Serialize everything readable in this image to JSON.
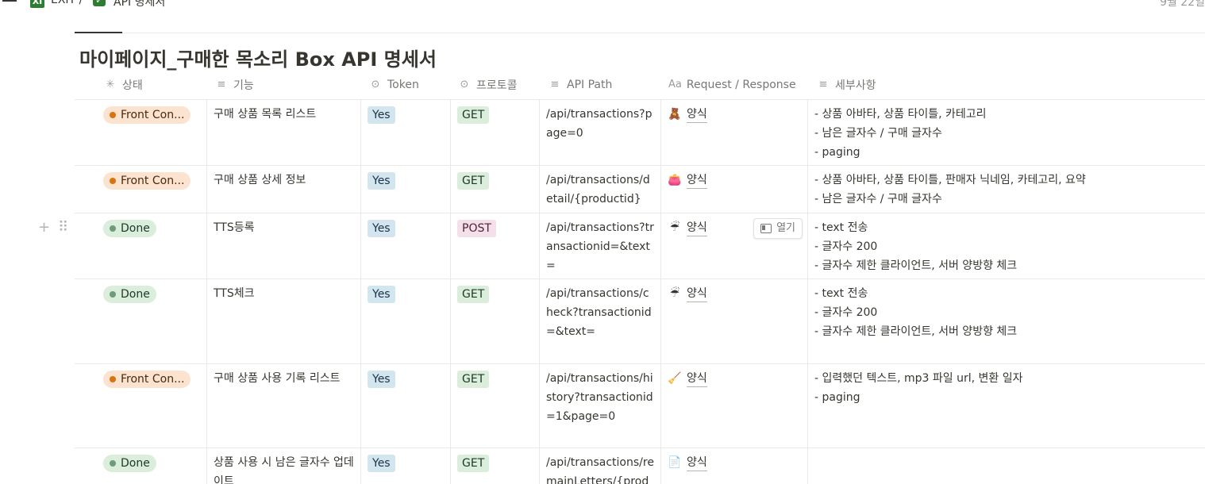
{
  "topbar": {
    "crumb1_icon": "XI",
    "crumb1": "EXIT /",
    "crumb2": "API 명세서",
    "date": "9월 22일"
  },
  "database": {
    "title": "마이페이지_구매한 목소리 Box API 명세서"
  },
  "columns": [
    {
      "label": "상태",
      "icon": "loading-icon"
    },
    {
      "label": "기능",
      "icon": "text-lines-icon"
    },
    {
      "label": "Token",
      "icon": "select-icon"
    },
    {
      "label": "프로토콜",
      "icon": "select-icon"
    },
    {
      "label": "API Path",
      "icon": "text-lines-icon"
    },
    {
      "label": "Request / Response",
      "icon": "title-aa-icon"
    },
    {
      "label": "세부사항",
      "icon": "text-lines-icon"
    }
  ],
  "open_button": "열기",
  "rows": [
    {
      "status": "Front Con...",
      "feature": "구매 상품 목록 리스트",
      "token": "Yes",
      "protocol": "GET",
      "path": "/api/transactions?page=0",
      "req_emoji": "🧸",
      "req_label": "양식",
      "details": [
        "- 상품 아바타, 상품 타이틀, 카테고리",
        "- 남은 글자수 / 구매 글자수",
        "- paging"
      ]
    },
    {
      "status": "Front Con...",
      "feature": "구매 상품 상세 정보",
      "token": "Yes",
      "protocol": "GET",
      "path": "/api/transactions/detail/{productid}",
      "req_emoji": "👛",
      "req_label": "양식",
      "details": [
        "- 상품 아바타, 상품 타이틀, 판매자 닉네임, 카테고리, 요약",
        "- 남은 글자수 / 구매 글자수"
      ]
    },
    {
      "status": "Done",
      "feature": "TTS등록",
      "token": "Yes",
      "protocol": "POST",
      "path": "/api/transactions?transactionid=&text=",
      "req_emoji": "☔",
      "req_label": "양식",
      "details": [
        "- text 전송",
        "- 글자수 200",
        "- 글자수 제한 클라이언트, 서버 양방향 체크"
      ]
    },
    {
      "status": "Done",
      "feature": "TTS체크",
      "token": "Yes",
      "protocol": "GET",
      "path": "/api/transactions/check?transactionid=&text=",
      "req_emoji": "☔",
      "req_label": "양식",
      "details": [
        "- text 전송",
        "- 글자수 200",
        "- 글자수 제한 클라이언트, 서버 양방향 체크"
      ]
    },
    {
      "status": "Front Con...",
      "feature": "구매 상품 사용 기록 리스트",
      "token": "Yes",
      "protocol": "GET",
      "path": "/api/transactions/history?transactionid=1&page=0",
      "req_emoji": "🧹",
      "req_label": "양식",
      "details": [
        "- 입력했던 텍스트, mp3 파일 url, 변환 일자",
        "- paging"
      ]
    },
    {
      "status": "Done",
      "feature": "상품 사용 시 남은 글자수 업데이트",
      "token": "Yes",
      "protocol": "GET",
      "path": "/api/transactions/remainLetters/{prod",
      "req_emoji": "📄",
      "req_label": "양식",
      "details": []
    }
  ]
}
